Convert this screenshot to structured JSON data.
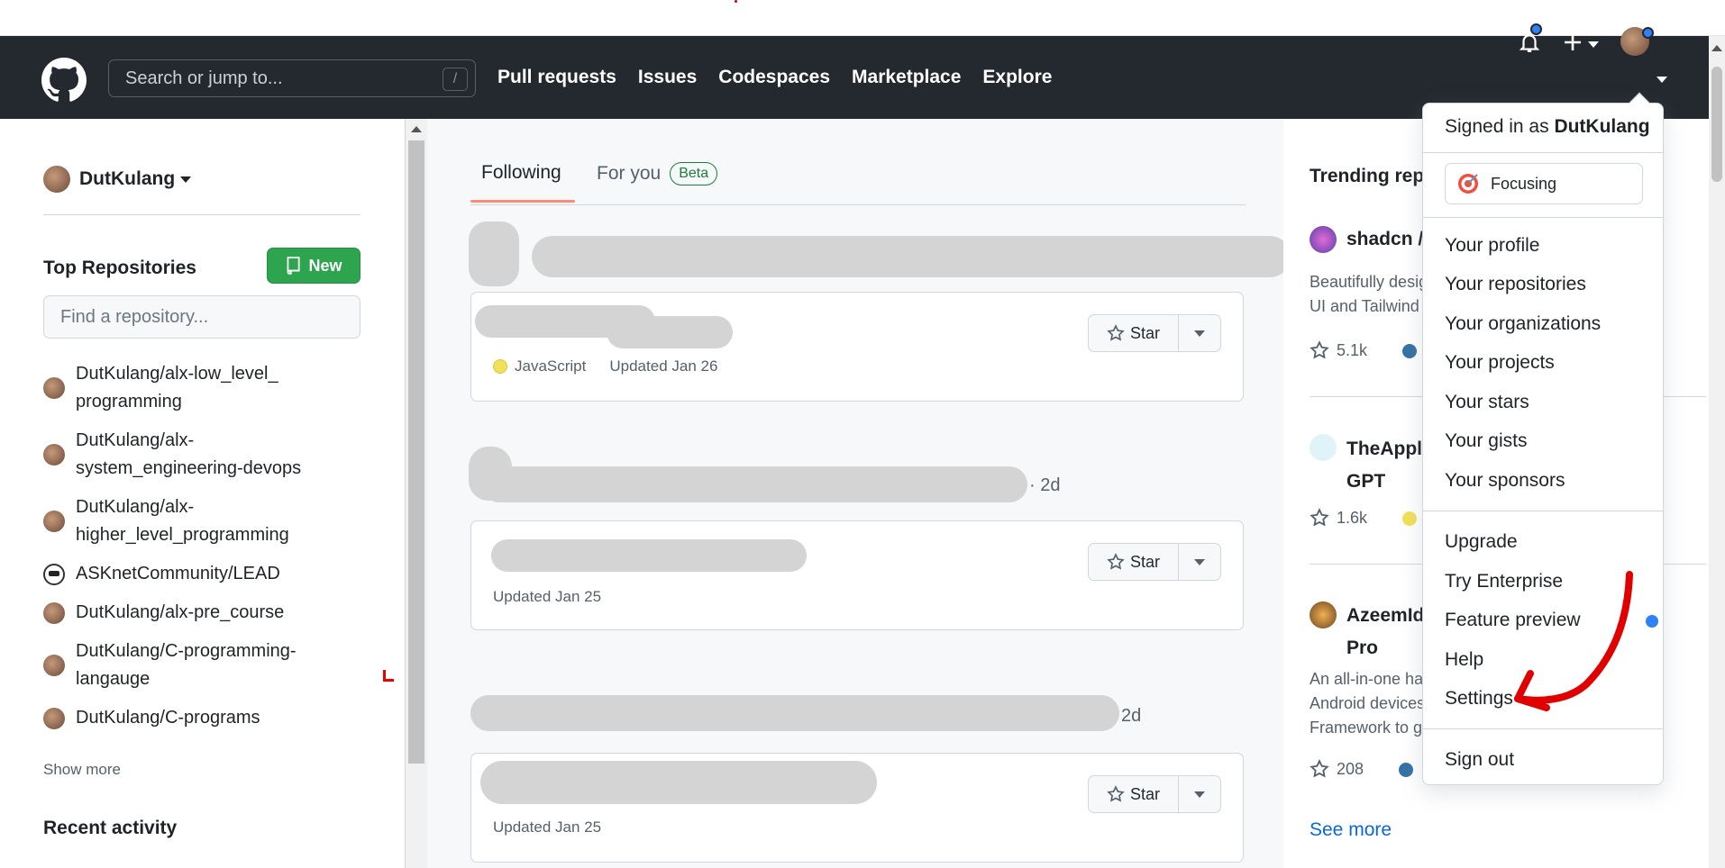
{
  "header": {
    "search_placeholder": "Search or jump to...",
    "search_shortcut": "/",
    "nav": [
      "Pull requests",
      "Issues",
      "Codespaces",
      "Marketplace",
      "Explore"
    ],
    "icons": [
      "github-logo-icon",
      "bell-icon",
      "plus-icon",
      "avatar"
    ]
  },
  "sidebar": {
    "username": "DutKulang",
    "top_repos_title": "Top Repositories",
    "new_label": "New",
    "find_placeholder": "Find a repository...",
    "repos": [
      "DutKulang/alx-low_level_programming",
      "DutKulang/alx-system_engineering-devops",
      "DutKulang/alx-higher_level_programming",
      "ASKnetCommunity/LEAD",
      "DutKulang/alx-pre_course",
      "DutKulang/C-programming-langauge",
      "DutKulang/C-programs"
    ],
    "show_more": "Show more",
    "recent_activity": "Recent activity"
  },
  "feed": {
    "tabs": {
      "following": "Following",
      "for_you": "For you",
      "beta": "Beta"
    },
    "cards": [
      {
        "language": "JavaScript",
        "updated": "Updated Jan 26",
        "star": "Star"
      },
      {
        "time": "· 2d",
        "updated": "Updated Jan 25",
        "star": "Star"
      },
      {
        "time": "2d",
        "updated": "Updated Jan 25",
        "star": "Star"
      }
    ]
  },
  "trending": {
    "title": "Trending repo",
    "items": [
      {
        "name": "shadcn /",
        "desc": "Beautifully desig\nUI and Tailwind",
        "stars": "5.1k"
      },
      {
        "name": "TheApple\nGPT",
        "stars": "1.6k"
      },
      {
        "name": "AzeemId\nPro",
        "desc": "An all-in-one ha\nAndroid devices\nFramework to g",
        "stars": "208"
      }
    ],
    "see_more": "See more"
  },
  "dropdown": {
    "signed_in_prefix": "Signed in as",
    "signed_in_user": "DutKulang",
    "status": "Focusing",
    "group1": [
      "Your profile",
      "Your repositories",
      "Your organizations",
      "Your projects",
      "Your stars",
      "Your gists",
      "Your sponsors"
    ],
    "group2": [
      "Upgrade",
      "Try Enterprise",
      "Feature preview",
      "Help",
      "Settings"
    ],
    "sign_out": "Sign out"
  },
  "colors": {
    "header_bg": "#24292f",
    "new_button": "#2da44e",
    "notification_dot": "#2f81f7",
    "tab_underline": "#fd8c73",
    "annotation_arrow": "#e00000"
  }
}
